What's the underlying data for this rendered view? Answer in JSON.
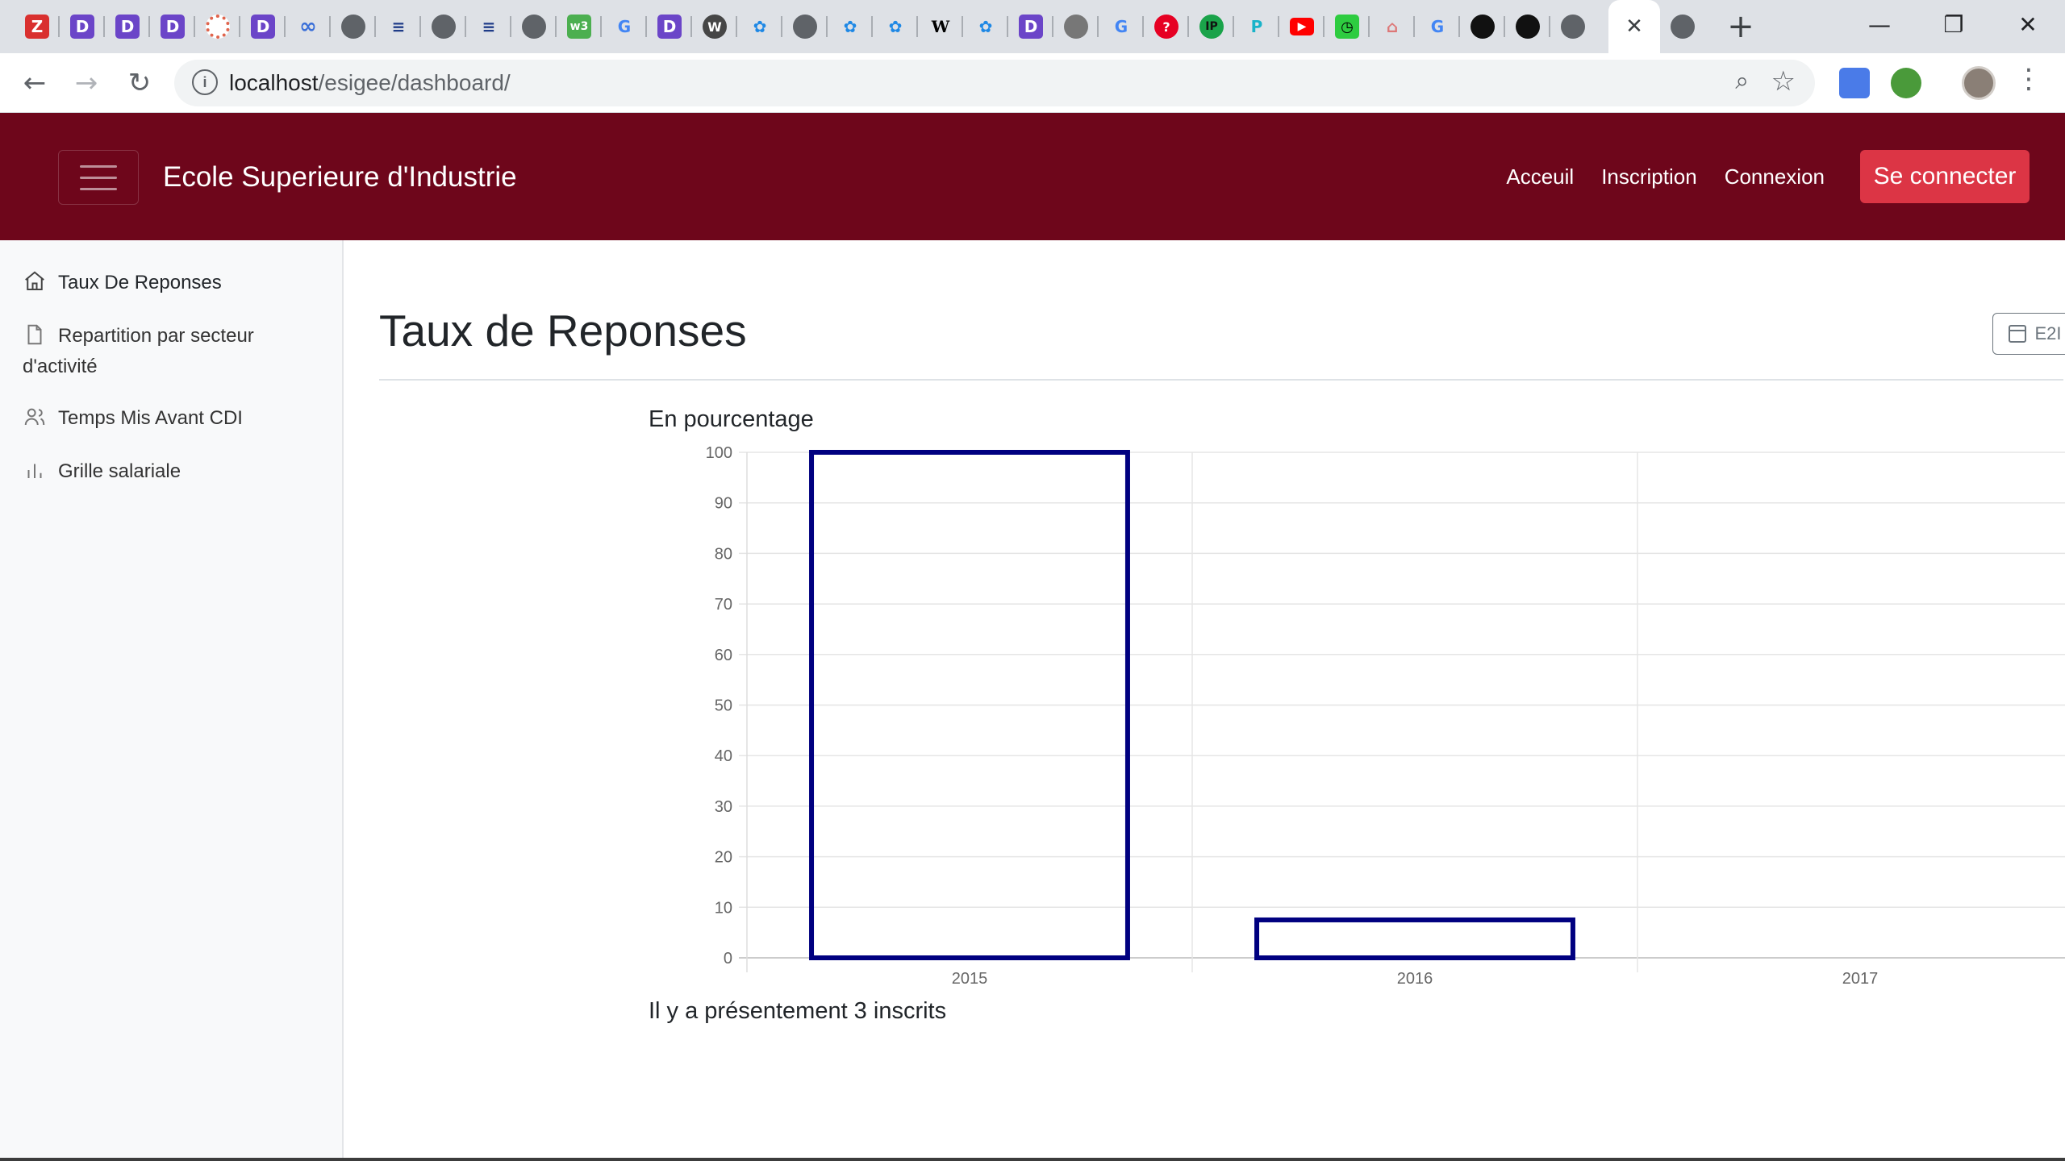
{
  "browser": {
    "address": {
      "host": "localhost",
      "path": "/esigee/dashboard/"
    },
    "active_tab_close": "✕",
    "new_tab": "+",
    "window_controls": {
      "minimize": "—",
      "restore": "❐",
      "close": "✕"
    }
  },
  "navbar": {
    "brand": "Ecole Superieure d'Industrie",
    "links": [
      "Acceuil",
      "Inscription",
      "Connexion"
    ],
    "cta": "Se connecter",
    "color": "#6e061b",
    "cta_color": "#dc3545"
  },
  "sidebar": {
    "items": [
      {
        "label": "Taux De Reponses",
        "icon": "home-icon"
      },
      {
        "label": "Repartition par secteur d'activité",
        "icon": "file-icon"
      },
      {
        "label": "Temps Mis Avant CDI",
        "icon": "users-icon"
      },
      {
        "label": "Grille salariale",
        "icon": "bar-chart-icon"
      }
    ]
  },
  "main": {
    "title": "Taux de Reponses",
    "filter": "E2I",
    "chart_heading": "En pourcentage",
    "footer": "Il y a présentement 3 inscrits"
  },
  "chart_data": {
    "type": "bar",
    "categories": [
      "2015",
      "2016",
      "2017"
    ],
    "values": [
      100,
      7.5,
      0
    ],
    "ylim": [
      0,
      100
    ],
    "yticks": [
      0,
      10,
      20,
      30,
      40,
      50,
      60,
      70,
      80,
      90,
      100
    ],
    "grid": true,
    "bar_border_color": "#000080",
    "bar_fill": "none"
  }
}
